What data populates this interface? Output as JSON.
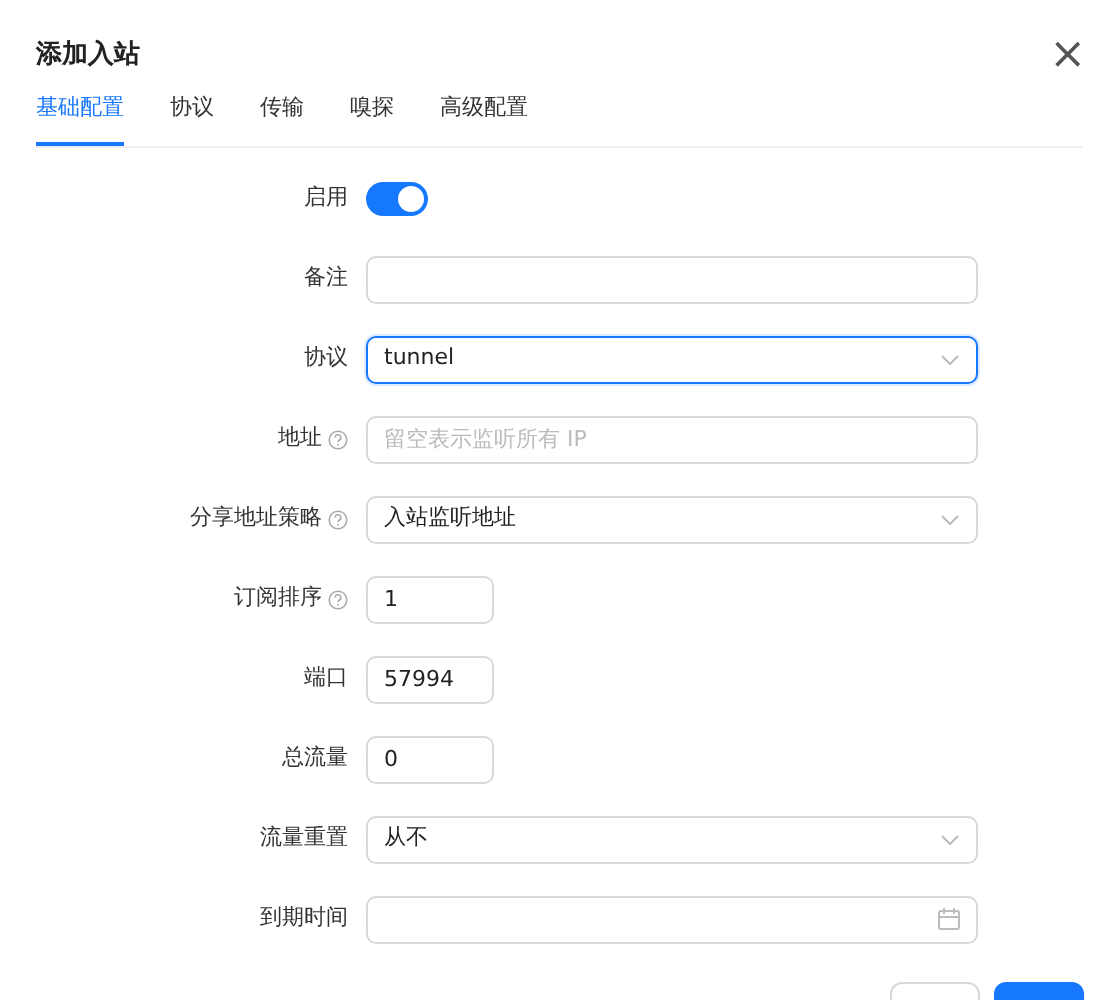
{
  "dialog": {
    "title": "添加入站",
    "close": "×"
  },
  "tabs": [
    {
      "label": "基础配置",
      "selected": true
    },
    {
      "label": "协议",
      "selected": false
    },
    {
      "label": "传输",
      "selected": false
    },
    {
      "label": "嗅探",
      "selected": false
    },
    {
      "label": "高级配置",
      "selected": false
    }
  ],
  "fields": [
    {
      "label": "启用",
      "kind": "switch",
      "on": true
    },
    {
      "label": "备注",
      "kind": "text"
    },
    {
      "label": "协议",
      "kind": "select",
      "value": "tunnel",
      "focused": true
    },
    {
      "label": "地址",
      "kind": "text",
      "help": true,
      "placeholder": "留空表示监听所有 IP"
    },
    {
      "label": "分享地址策略",
      "kind": "select",
      "help": true,
      "value": "入站监听地址"
    },
    {
      "label": "订阅排序",
      "kind": "number",
      "help": true,
      "value": "1"
    },
    {
      "label": "端口",
      "kind": "number",
      "value": "57994"
    },
    {
      "label": "总流量",
      "kind": "number",
      "value": "0"
    },
    {
      "label": "流量重置",
      "kind": "select",
      "value": "从不"
    },
    {
      "label": "到期时间",
      "kind": "date"
    }
  ],
  "footer_buttons": [
    {
      "kind": "default"
    },
    {
      "kind": "primary"
    }
  ]
}
